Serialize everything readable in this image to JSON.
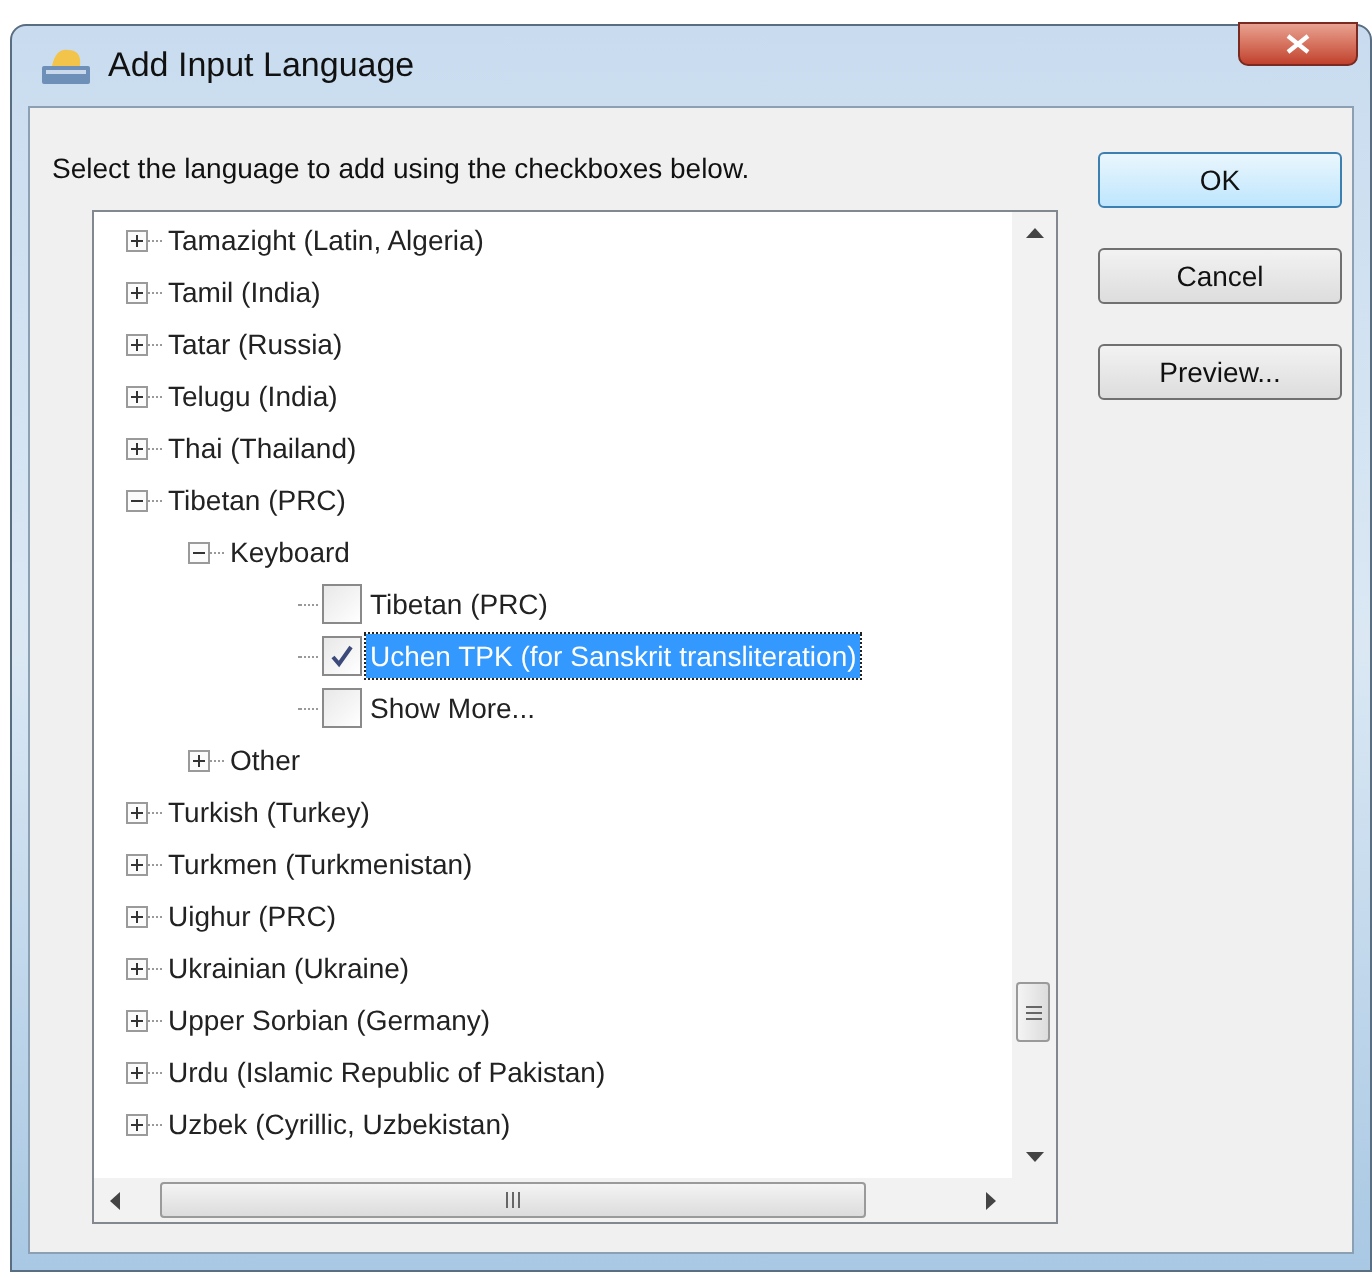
{
  "window": {
    "title": "Add Input Language"
  },
  "instruction": "Select the language to add using the checkboxes below.",
  "tree": {
    "items": [
      {
        "label": "Tamazight (Latin, Algeria)",
        "kind": "node",
        "expanded": false
      },
      {
        "label": "Tamil (India)",
        "kind": "node",
        "expanded": false
      },
      {
        "label": "Tatar (Russia)",
        "kind": "node",
        "expanded": false
      },
      {
        "label": "Telugu (India)",
        "kind": "node",
        "expanded": false
      },
      {
        "label": "Thai (Thailand)",
        "kind": "node",
        "expanded": false
      },
      {
        "label": "Tibetan (PRC)",
        "kind": "node",
        "expanded": true,
        "children": [
          {
            "label": "Keyboard",
            "kind": "node",
            "expanded": true,
            "children": [
              {
                "label": "Tibetan (PRC)",
                "kind": "checkbox",
                "checked": false,
                "selected": false
              },
              {
                "label": "Uchen TPK (for Sanskrit transliteration)",
                "kind": "checkbox",
                "checked": true,
                "selected": true
              },
              {
                "label": "Show More...",
                "kind": "checkbox",
                "checked": false,
                "selected": false
              }
            ]
          },
          {
            "label": "Other",
            "kind": "node",
            "expanded": false
          }
        ]
      },
      {
        "label": "Turkish (Turkey)",
        "kind": "node",
        "expanded": false
      },
      {
        "label": "Turkmen (Turkmenistan)",
        "kind": "node",
        "expanded": false
      },
      {
        "label": "Uighur (PRC)",
        "kind": "node",
        "expanded": false
      },
      {
        "label": "Ukrainian (Ukraine)",
        "kind": "node",
        "expanded": false
      },
      {
        "label": "Upper Sorbian (Germany)",
        "kind": "node",
        "expanded": false
      },
      {
        "label": "Urdu (Islamic Republic of Pakistan)",
        "kind": "node",
        "expanded": false
      },
      {
        "label": "Uzbek (Cyrillic, Uzbekistan)",
        "kind": "node",
        "expanded": false
      }
    ]
  },
  "buttons": [
    {
      "label": "OK",
      "default": true
    },
    {
      "label": "Cancel",
      "default": false
    },
    {
      "label": "Preview...",
      "default": false
    }
  ]
}
